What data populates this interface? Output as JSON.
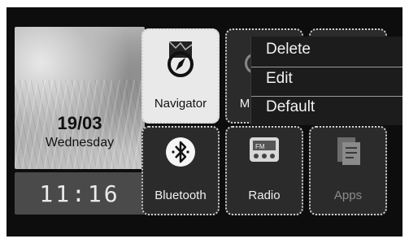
{
  "clock": {
    "date": "19/03",
    "weekday": "Wednesday",
    "time": "11:16"
  },
  "apps": {
    "navigator": "Navigator",
    "media_partial": "M",
    "bluetooth": "Bluetooth",
    "radio": "Radio",
    "apps": "Apps"
  },
  "context_menu": {
    "items": [
      "Delete",
      "Edit",
      "Default"
    ]
  },
  "icons": {
    "navigator": "compass-map-icon",
    "media": "media-icon",
    "bluetooth": "bluetooth-icon",
    "radio": "fm-radio-icon",
    "apps": "apps-icon"
  }
}
